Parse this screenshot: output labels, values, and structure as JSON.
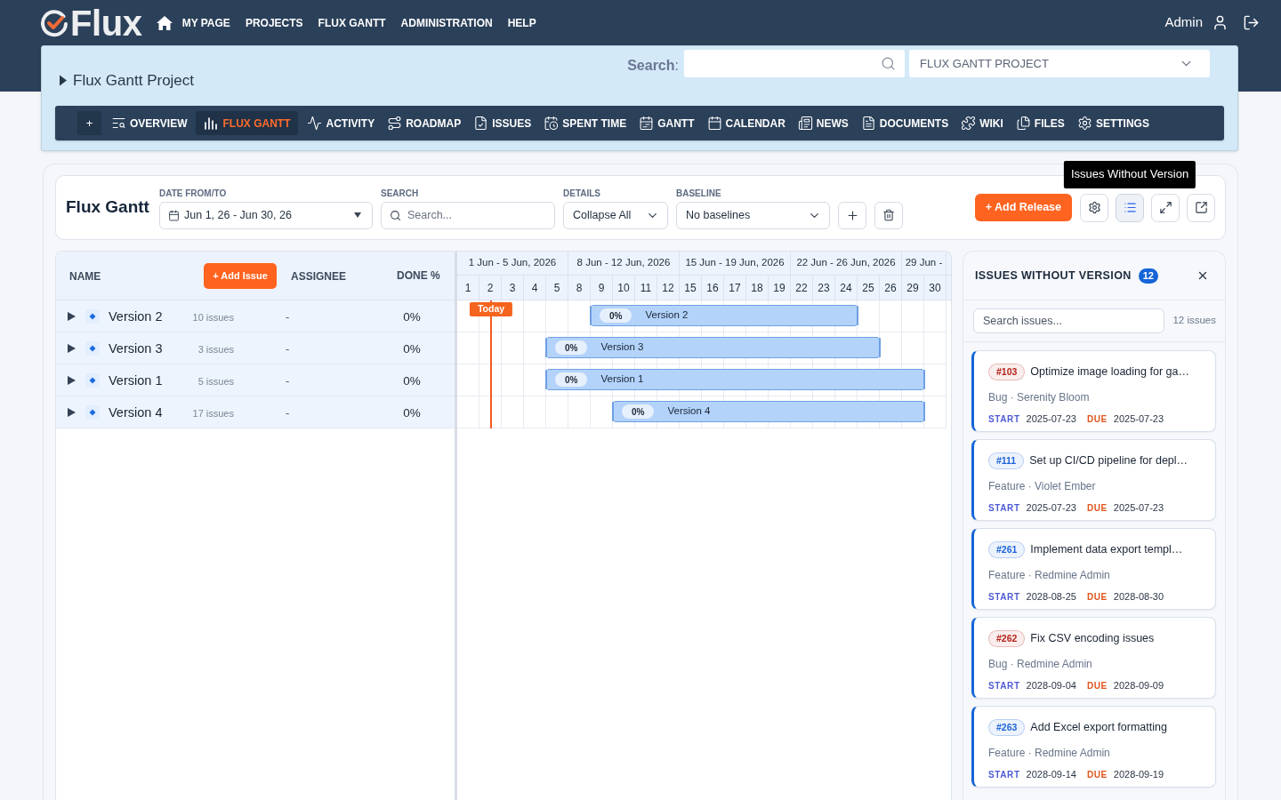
{
  "header": {
    "logo": "Flux",
    "nav": [
      "MY PAGE",
      "PROJECTS",
      "FLUX GANTT",
      "ADMINISTRATION",
      "HELP"
    ],
    "user": "Admin"
  },
  "project": {
    "title": "Flux Gantt Project",
    "search_label": "**Search**:",
    "project_select": "FLUX GANTT PROJECT"
  },
  "menu": {
    "add": "+",
    "tabs": [
      {
        "label": "OVERVIEW",
        "selected": false
      },
      {
        "label": "FLUX GANTT",
        "selected": true
      },
      {
        "label": "ACTIVITY",
        "selected": false
      },
      {
        "label": "ROADMAP",
        "selected": false
      },
      {
        "label": "ISSUES",
        "selected": false
      },
      {
        "label": "SPENT TIME",
        "selected": false
      },
      {
        "label": "GANTT",
        "selected": false
      },
      {
        "label": "CALENDAR",
        "selected": false
      },
      {
        "label": "NEWS",
        "selected": false
      },
      {
        "label": "DOCUMENTS",
        "selected": false
      },
      {
        "label": "WIKI",
        "selected": false
      },
      {
        "label": "FILES",
        "selected": false
      },
      {
        "label": "SETTINGS",
        "selected": false
      }
    ]
  },
  "toolbar": {
    "title": "Flux Gantt",
    "date_range": {
      "label": "DATE FROM/TO",
      "value": "Jun 1, 26 - Jun 30, 26"
    },
    "search": {
      "label": "SEARCH",
      "placeholder": "Search..."
    },
    "details": {
      "label": "DETAILS",
      "value": "Collapse All"
    },
    "baseline": {
      "label": "BASELINE",
      "value": "No baselines"
    },
    "add_release": "+ Add Release",
    "tools": [
      {
        "kind": "settings",
        "selected": false
      },
      {
        "kind": "list",
        "selected": true,
        "tooltip": "Issues Without Version"
      },
      {
        "kind": "expand",
        "selected": false
      },
      {
        "kind": "external",
        "selected": false
      }
    ]
  },
  "table": {
    "columns": {
      "name": "NAME",
      "add_issue": "+ Add Issue",
      "assignee": "ASSIGNEE",
      "done": "DONE %"
    },
    "rows": [
      {
        "name": "Version 2",
        "issues": "10 issues",
        "assignee": "-",
        "done": "0%",
        "expanded": false,
        "bar": {
          "done": "0%",
          "label": "Version 2",
          "start": {
            "level": 0.2727
          },
          "end": {
            "level": 0.8182
          }
        }
      },
      {
        "name": "Version 3",
        "issues": "3 issues",
        "assignee": "-",
        "done": "0%",
        "expanded": false,
        "bar": {
          "done": "0%",
          "label": "Version 3",
          "start": {
            "level": 0.1818
          },
          "end": {
            "level": 0.8636
          }
        }
      },
      {
        "name": "Version 1",
        "issues": "5 issues",
        "assignee": "-",
        "done": "0%",
        "expanded": false,
        "bar": {
          "done": "0%",
          "label": "Version 1",
          "start": {
            "level": 0.1818
          },
          "end": {
            "level": 0.9545
          }
        }
      },
      {
        "name": "Version 4",
        "issues": "17 issues",
        "assignee": "-",
        "done": "0%",
        "expanded": false,
        "bar": {
          "done": "0%",
          "label": "Version 4",
          "start": {
            "level": 0.3182
          },
          "end": {
            "level": 0.9545
          }
        }
      }
    ]
  },
  "timeline": {
    "weeks": [
      "1 Jun - 5 Jun, 2026",
      "8 Jun - 12 Jun, 2026",
      "15 Jun - 19 Jun, 2026",
      "22 Jun - 26 Jun, 2026",
      "29 Jun -"
    ],
    "days": [
      "1",
      "2",
      "3",
      "4",
      "5",
      "8",
      "9",
      "10",
      "11",
      "12",
      "15",
      "16",
      "17",
      "18",
      "19",
      "22",
      "23",
      "24",
      "25",
      "26",
      "29",
      "30"
    ],
    "today": {
      "label": "Today",
      "level": 0.0682
    }
  },
  "issues_panel": {
    "title": "ISSUES WITHOUT VERSION",
    "count": "12",
    "search": {
      "placeholder": "Search issues..."
    },
    "total": "12 issues",
    "issues": [
      {
        "id": "#103",
        "color": "#b42318",
        "title": "Optimize image loading for ga…",
        "meta": "Bug · Serenity Bloom",
        "start_label": "START",
        "start": "2025-07-23",
        "due_label": "DUE",
        "due": "2025-07-23"
      },
      {
        "id": "#111",
        "color": "#1d64d8",
        "title": "Set up CI/CD pipeline for depl…",
        "meta": "Feature · Violet Ember",
        "start_label": "START",
        "start": "2025-07-23",
        "due_label": "DUE",
        "due": "2025-07-23"
      },
      {
        "id": "#261",
        "color": "#1d64d8",
        "title": "Implement data export templ…",
        "meta": "Feature · Redmine Admin",
        "start_label": "START",
        "start": "2028-08-25",
        "due_label": "DUE",
        "due": "2028-08-30"
      },
      {
        "id": "#262",
        "color": "#b42318",
        "title": "Fix CSV encoding issues",
        "meta": "Bug · Redmine Admin",
        "start_label": "START",
        "start": "2028-09-04",
        "due_label": "DUE",
        "due": "2028-09-09"
      },
      {
        "id": "#263",
        "color": "#1d64d8",
        "title": "Add Excel export formatting",
        "meta": "Feature · Redmine Admin",
        "start_label": "START",
        "start": "2028-09-14",
        "due_label": "DUE",
        "due": "2028-09-19"
      }
    ]
  }
}
